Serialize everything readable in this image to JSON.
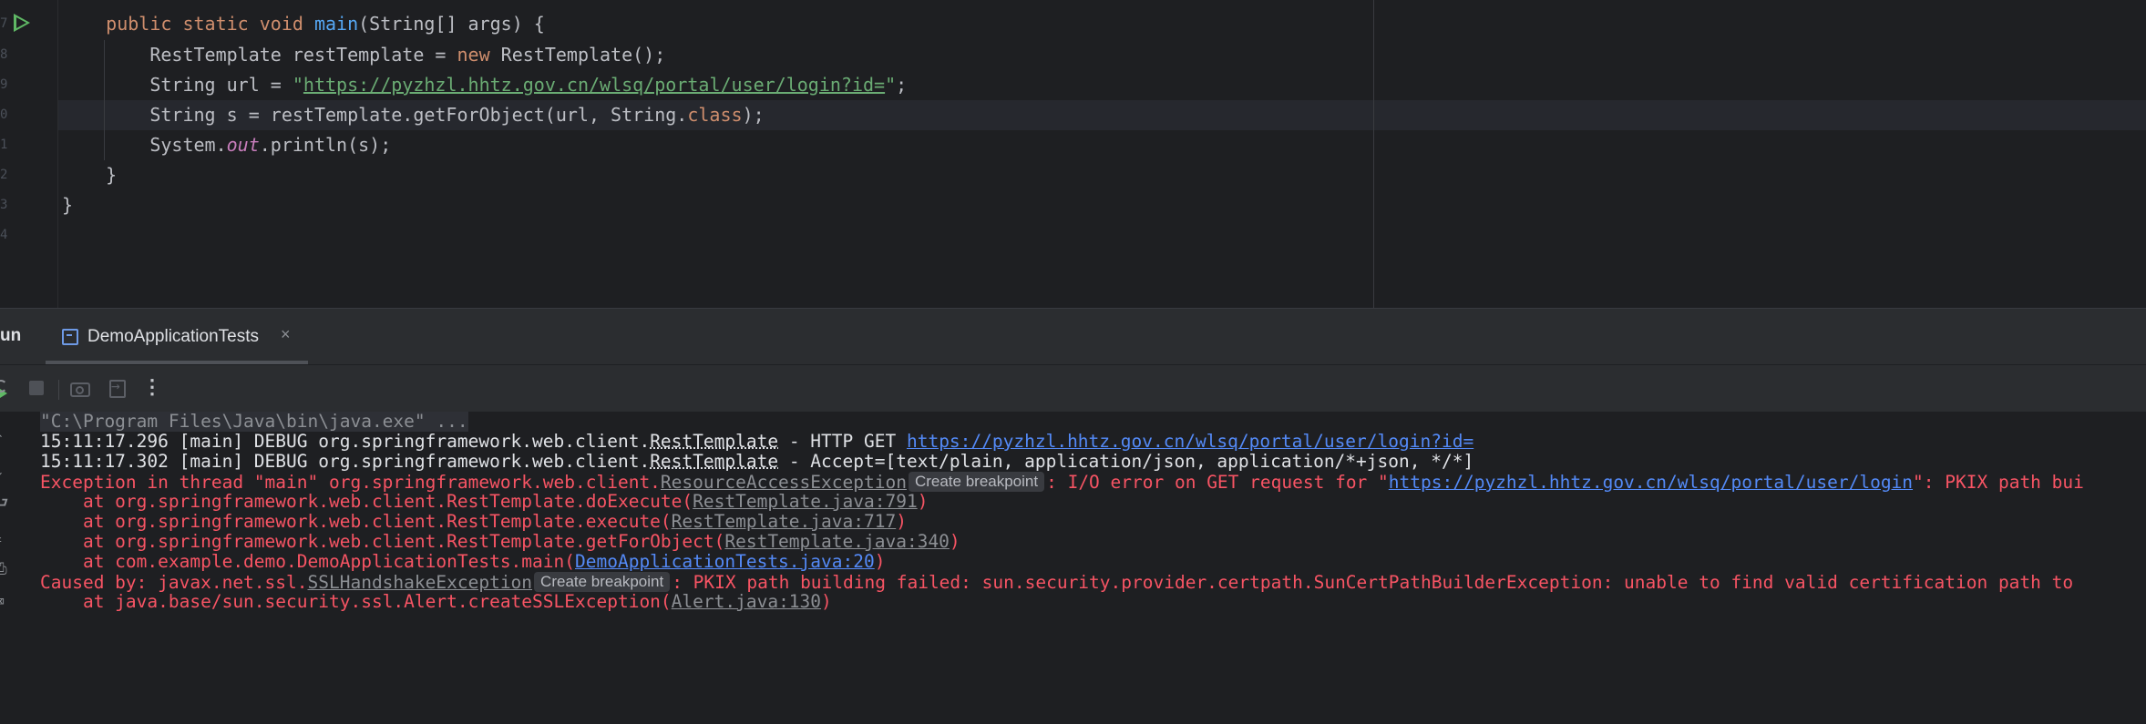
{
  "editor": {
    "gutter_numbers": [
      "7",
      "8",
      "9",
      "0",
      "1",
      "2",
      "3",
      "4"
    ],
    "lines": {
      "l1": {
        "kw1": "public static void ",
        "fn": "main",
        "rest": "(String[] args) {"
      },
      "l2": {
        "a": "RestTemplate restTemplate = ",
        "kw": "new",
        "b": " RestTemplate();"
      },
      "l3": {
        "a": "String url = ",
        "q1": "\"",
        "url": "https://pyzhzl.hhtz.gov.cn/wlsq/portal/user/login?id=",
        "q2": "\"",
        "b": ";"
      },
      "l4": {
        "a": "String s = restTemplate.getForObject(url, String.",
        "kw": "class",
        "b": ");"
      },
      "l5": {
        "a": "System.",
        "field": "out",
        "b": ".println(s);"
      },
      "l6": "}",
      "l7": "}"
    }
  },
  "run_panel": {
    "title": "un",
    "tab_label": "DemoApplicationTests",
    "tab_close": "×",
    "more_icon": "⋮"
  },
  "console": {
    "cmd_line": "\"C:\\Program Files\\Java\\bin\\java.exe\" ...",
    "log1": {
      "a": "15:11:17.296 [main] DEBUG org.springframework.web.client.",
      "cls": "RestTemplate",
      "b": " - HTTP GET ",
      "url": "https://pyzhzl.hhtz.gov.cn/wlsq/portal/user/login?id="
    },
    "log2": {
      "a": "15:11:17.302 [main] DEBUG org.springframework.web.client.",
      "cls": "RestTemplate",
      "b": " - Accept=[text/plain, application/json, application/*+json, */*]"
    },
    "exc": {
      "a": "Exception in thread \"main\" org.springframework.web.client.",
      "cls": "ResourceAccessException",
      "chip": "Create breakpoint",
      "b": ": I/O error on GET request for \"",
      "url": "https://pyzhzl.hhtz.gov.cn/wlsq/portal/user/login",
      "c": "\": PKIX path bui"
    },
    "st1": {
      "a": "    at org.springframework.web.client.RestTemplate.doExecute(",
      "src": "RestTemplate.java:791",
      "b": ")"
    },
    "st2": {
      "a": "    at org.springframework.web.client.RestTemplate.execute(",
      "src": "RestTemplate.java:717",
      "b": ")"
    },
    "st3": {
      "a": "    at org.springframework.web.client.RestTemplate.getForObject(",
      "src": "RestTemplate.java:340",
      "b": ")"
    },
    "st4": {
      "a": "    at com.example.demo.DemoApplicationTests.main(",
      "src": "DemoApplicationTests.java:20",
      "b": ")"
    },
    "cause": {
      "a": "Caused by: javax.net.ssl.",
      "cls": "SSLHandshakeException",
      "chip": "Create breakpoint",
      "b": ": PKIX path building failed: sun.security.provider.certpath.SunCertPathBuilderException: unable to find valid certification path to"
    },
    "st5": {
      "a": "    at java.base/sun.security.ssl.Alert.createSSLException(",
      "src": "Alert.java:130",
      "b": ")"
    }
  },
  "colors": {
    "background": "#1e1f22",
    "keyword": "#cf8e6d",
    "function": "#56a8f5",
    "string": "#6aab73",
    "error": "#f75464",
    "link": "#548af7",
    "run_green": "#5fb865"
  },
  "icons": [
    "run-gutter-icon",
    "rerun-icon",
    "stop-icon",
    "camera-icon",
    "exit-icon",
    "more-icon",
    "tab-icon",
    "close-icon"
  ]
}
